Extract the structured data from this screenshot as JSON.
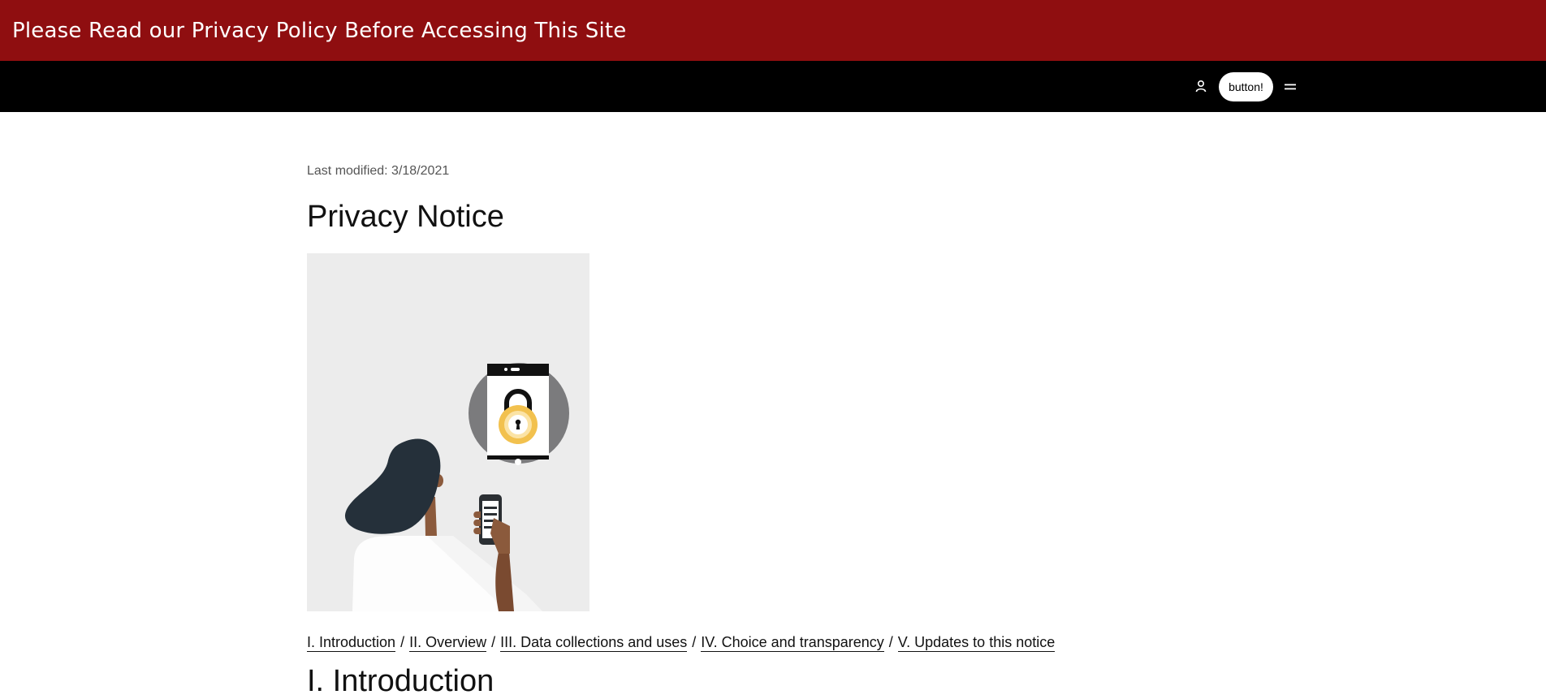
{
  "banner": {
    "text": "Please Read our Privacy Policy Before Accessing This Site"
  },
  "nav": {
    "user_icon": "person-icon",
    "button_label": "button!",
    "menu_icon": "menu-icon"
  },
  "page": {
    "last_modified": "Last modified: 3/18/2021",
    "title": "Privacy Notice",
    "hero_image": "person-holding-phone-with-padlock-illustration"
  },
  "toc": {
    "links": [
      "I. Introduction",
      "II. Overview",
      "III. Data collections and uses",
      "IV. Choice and transparency",
      "V. Updates to this notice"
    ],
    "separator": "/"
  },
  "section": {
    "heading": "I. Introduction"
  },
  "colors": {
    "banner_bg": "#8f0e10",
    "navbar_bg": "#000000",
    "hero_bg": "#ececec",
    "lock_gold": "#f2c14e"
  }
}
